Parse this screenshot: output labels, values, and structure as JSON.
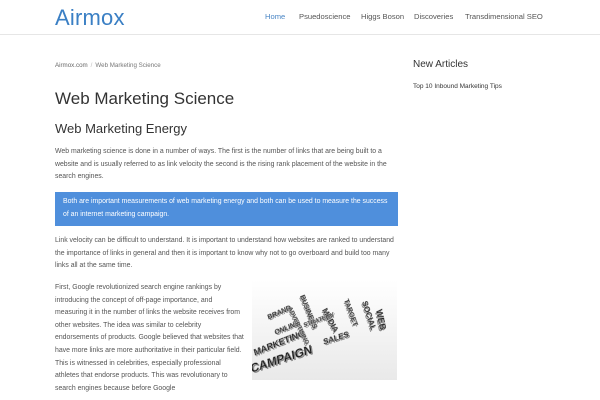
{
  "site": {
    "logo": "Airmox"
  },
  "nav": {
    "items": [
      {
        "label": "Home"
      },
      {
        "label": "Psuedoscience"
      },
      {
        "label": "Higgs Boson"
      },
      {
        "label": "Discoveries"
      },
      {
        "label": "Transdimensional SEO"
      }
    ],
    "active": "Home"
  },
  "breadcrumb": {
    "home": "Airmox.com",
    "current": "Web Marketing Science"
  },
  "article": {
    "title": "Web Marketing Science",
    "subtitle": "Web Marketing Energy",
    "p1": "Web marketing science is done in a number of ways. The first is the number of links that are being built to a website and is usually referred to as link velocity the second is the rising rank placement of the website in the search engines.",
    "callout": "Both are important measurements of web marketing energy and both can be used to measure the success of an internet marketing campaign.",
    "p2": "Link velocity can be difficult to understand. It is important to understand how websites are ranked to understand the importance of links in general and then it is important to know why not to go overboard and build too many links all at the same time.",
    "p3": "First, Google revolutionized search engine rankings by introducing the concept of off-page importance, and measuring it in the number of links the website receives from other websites. The idea was similar to celebrity endorsements of products. Google believed that websites that have more links are more authoritative in their particular field. This is witnessed in celebrities, especially professional athletes that endorse products. This was revolutionary to search engines because before Google",
    "image_words": [
      "MARKETING",
      "MEDIA",
      "BUSINESS",
      "SOCIAL",
      "CAMPAIGN",
      "TARGET",
      "ONLINE",
      "WEB",
      "BRAND",
      "STRATEGY",
      "SALES",
      "ADVERTISING"
    ]
  },
  "sidebar": {
    "title": "New Articles",
    "links": [
      {
        "label": "Top 10 Inbound Marketing Tips"
      }
    ]
  },
  "colors": {
    "brand": "#3a7fc4",
    "callout": "#4f8fdc"
  }
}
